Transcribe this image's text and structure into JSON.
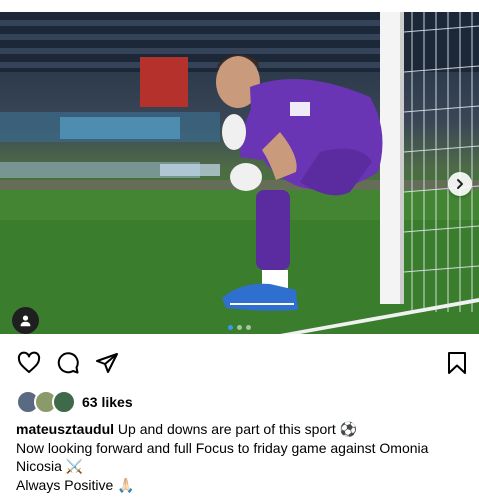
{
  "post": {
    "media": {
      "alt_icon": "goalkeeper-photo",
      "carousel_dot_count": 3,
      "active_dot": 0
    },
    "likes": {
      "count_label": "63 likes",
      "avatar_colors": [
        "#5a6a82",
        "#8a9a6a",
        "#3e6a4a"
      ]
    },
    "caption": {
      "username": "mateusztaudul",
      "line1": "Up and downs are part of this sport ⚽",
      "line2": "Now looking forward and full Focus to friday game against Omonia",
      "line3": "Nicosia ⚔️",
      "line4": "Always Positive 🙏🏻"
    },
    "icons": {
      "like": "heart-icon",
      "comment": "comment-icon",
      "share": "share-icon",
      "save": "bookmark-icon",
      "account": "user-icon",
      "next": "chevron-right-icon"
    },
    "colors": {
      "accent": "#3897f0",
      "kit_purple": "#6a35b5",
      "pitch_green": "#3a7a2c"
    }
  }
}
